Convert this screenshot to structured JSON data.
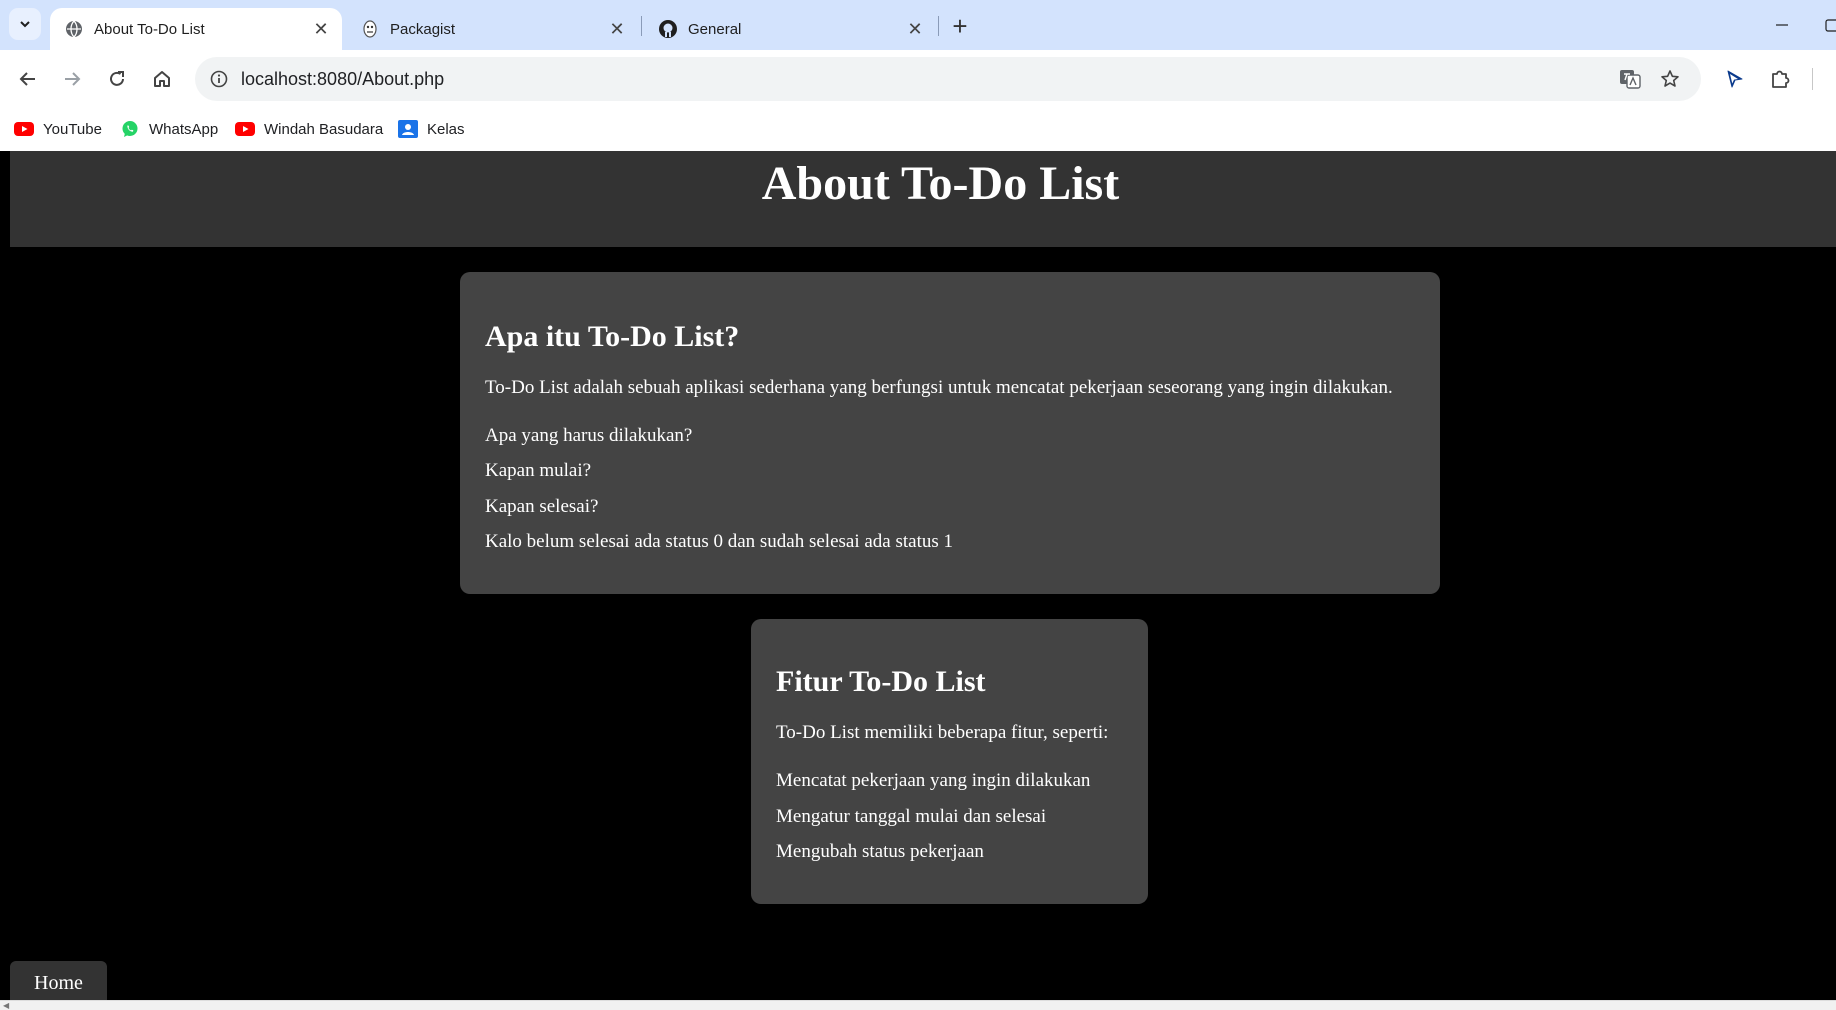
{
  "browser": {
    "tabs": [
      {
        "title": "About To-Do List",
        "icon": "globe-icon",
        "active": true
      },
      {
        "title": "Packagist",
        "icon": "packagist-icon",
        "active": false
      },
      {
        "title": "General",
        "icon": "github-icon",
        "active": false
      }
    ],
    "tab_close_glyph": "✕",
    "new_tab_glyph": "+",
    "url": "localhost:8080/About.php",
    "bookmarks": [
      {
        "label": "YouTube",
        "icon": "youtube-icon",
        "color": "#ff0000"
      },
      {
        "label": "WhatsApp",
        "icon": "whatsapp-icon",
        "color": "#25d366"
      },
      {
        "label": "Windah Basudara",
        "icon": "youtube-icon",
        "color": "#ff0000"
      },
      {
        "label": "Kelas",
        "icon": "classroom-icon",
        "color": "#1a73e8"
      }
    ]
  },
  "page": {
    "header_title": "About To-Do List",
    "section1": {
      "heading": "Apa itu To-Do List?",
      "intro": "To-Do List adalah sebuah aplikasi sederhana yang berfungsi untuk mencatat pekerjaan seseorang yang ingin dilakukan.",
      "items": [
        "Apa yang harus dilakukan?",
        "Kapan mulai?",
        "Kapan selesai?",
        "Kalo belum selesai ada status 0 dan sudah selesai ada status 1"
      ]
    },
    "section2": {
      "heading": "Fitur To-Do List",
      "intro": "To-Do List memiliki beberapa fitur, seperti:",
      "items": [
        "Mencatat pekerjaan yang ingin dilakukan",
        "Mengatur tanggal mulai dan selesai",
        "Mengubah status pekerjaan"
      ]
    },
    "home_label": "Home"
  },
  "colors": {
    "tabstrip": "#d3e3fd",
    "page_background": "#000000",
    "header_background": "#333333",
    "card_background": "#444444"
  }
}
